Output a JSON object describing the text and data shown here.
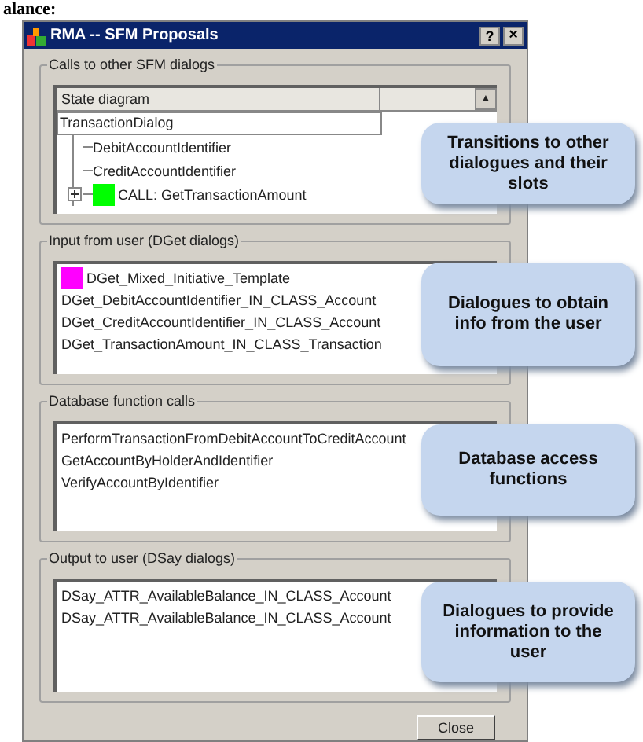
{
  "caption": "alance:",
  "window": {
    "title": "RMA -- SFM Proposals",
    "help_button": "?",
    "close_button": "×"
  },
  "calls_group": {
    "label": "Calls to other SFM dialogs",
    "column_header": "State diagram",
    "scroll_arrow": "▲",
    "root": "TransactionDialog",
    "children": [
      {
        "text": "DebitAccountIdentifier",
        "kind": "leaf"
      },
      {
        "text": "CreditAccountIdentifier",
        "kind": "leaf"
      },
      {
        "text": "CALL: GetTransactionAmount",
        "kind": "collapsed",
        "color": "#00ff00"
      }
    ]
  },
  "input_group": {
    "label": "Input from user (DGet dialogs)",
    "items": [
      {
        "text": "DGet_Mixed_Initiative_Template",
        "color": "#ff00ff"
      },
      {
        "text": "DGet_DebitAccountIdentifier_IN_CLASS_Account"
      },
      {
        "text": "DGet_CreditAccountIdentifier_IN_CLASS_Account"
      },
      {
        "text": "DGet_TransactionAmount_IN_CLASS_Transaction"
      }
    ]
  },
  "database_group": {
    "label": "Database function calls",
    "items": [
      {
        "text": "PerformTransactionFromDebitAccountToCreditAccount"
      },
      {
        "text": "GetAccountByHolderAndIdentifier"
      },
      {
        "text": "VerifyAccountByIdentifier"
      }
    ]
  },
  "output_group": {
    "label": "Output to user (DSay dialogs)",
    "items": [
      {
        "text": "DSay_ATTR_AvailableBalance_IN_CLASS_Account"
      },
      {
        "text": "DSay_ATTR_AvailableBalance_IN_CLASS_Account"
      }
    ]
  },
  "close_label": "Close",
  "callouts": [
    "Transitions to other dialogues and their slots",
    "Dialogues to obtain info from the user",
    "Database access functions",
    "Dialogues to provide information to the user"
  ]
}
